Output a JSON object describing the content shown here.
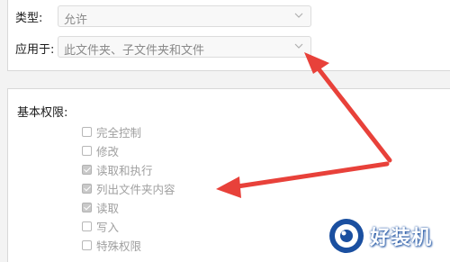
{
  "fields": {
    "type_label": "类型:",
    "type_value": "允许",
    "applies_label": "应用于:",
    "applies_value": "此文件夹、子文件夹和文件"
  },
  "permissions": {
    "title": "基本权限:",
    "items": [
      {
        "label": "完全控制",
        "checked": false
      },
      {
        "label": "修改",
        "checked": false
      },
      {
        "label": "读取和执行",
        "checked": true
      },
      {
        "label": "列出文件夹内容",
        "checked": true
      },
      {
        "label": "读取",
        "checked": true
      },
      {
        "label": "写入",
        "checked": false
      },
      {
        "label": "特殊权限",
        "checked": false
      }
    ]
  },
  "watermark": {
    "text": "好装机"
  },
  "colors": {
    "arrow": "#e8413a",
    "disabled_text": "#a0a0a0",
    "watermark_blue": "#1a4fa0"
  },
  "icons": [
    "chevron-down-icon",
    "red-arrow-annotation",
    "watermark-logo-icon"
  ]
}
